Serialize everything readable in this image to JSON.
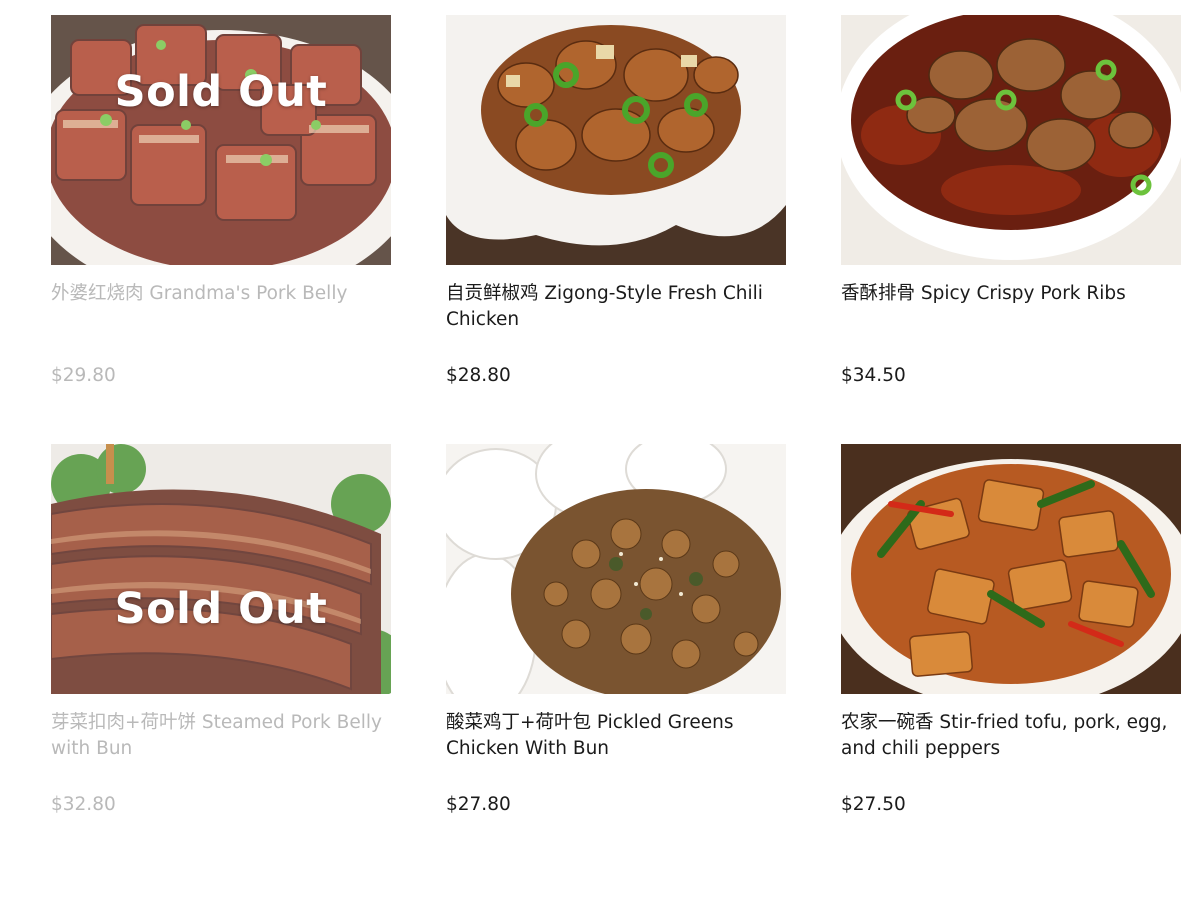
{
  "menu": {
    "items": [
      {
        "name": "外婆红烧肉 Grandma's Pork Belly",
        "price": "$29.80",
        "status": "Sold Out",
        "image": "braised-pork-belly"
      },
      {
        "name": "自贡鲜椒鸡 Zigong-Style Fresh Chili Chicken",
        "price": "$28.80",
        "status": "",
        "image": "chili-chicken"
      },
      {
        "name": "香酥排骨 Spicy Crispy Pork Ribs",
        "price": "$34.50",
        "status": "",
        "image": "crispy-pork-ribs"
      },
      {
        "name": "芽菜扣肉+荷叶饼 Steamed Pork Belly with Bun",
        "price": "$32.80",
        "status": "Sold Out",
        "image": "steamed-pork-belly"
      },
      {
        "name": "酸菜鸡丁+荷叶包 Pickled Greens Chicken With Bun",
        "price": "$27.80",
        "status": "",
        "image": "pickled-greens-chicken"
      },
      {
        "name": "农家一碗香 Stir-fried tofu, pork, egg, and chili peppers",
        "price": "$27.50",
        "status": "",
        "image": "stir-fried-tofu-pork"
      }
    ]
  },
  "colors": {
    "text": "#1b1b1b",
    "sold_out_text": "#b9b9b9",
    "sold_out_overlay": "#ffffff"
  }
}
